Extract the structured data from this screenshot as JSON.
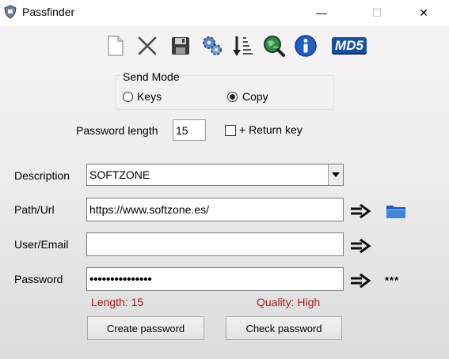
{
  "window": {
    "title": "Passfinder",
    "minimize": "—",
    "maximize": "☐",
    "close": "✕"
  },
  "toolbar": {
    "buttons": [
      {
        "icon": "new-document-icon"
      },
      {
        "icon": "delete-icon"
      },
      {
        "icon": "save-icon"
      },
      {
        "icon": "settings-gears-icon"
      },
      {
        "icon": "sort-down-icon"
      },
      {
        "icon": "search-globe-icon"
      },
      {
        "icon": "info-icon"
      },
      {
        "icon": "md5-icon",
        "label": "MD5"
      }
    ]
  },
  "send_mode": {
    "title": "Send Mode",
    "options": [
      {
        "label": "Keys",
        "selected": false
      },
      {
        "label": "Copy",
        "selected": true
      }
    ]
  },
  "password_length": {
    "label": "Password length",
    "value": "15"
  },
  "return_key": {
    "label": "+ Return key",
    "checked": false
  },
  "form": {
    "description": {
      "label": "Description",
      "value": "SOFTZONE"
    },
    "path": {
      "label": "Path/Url",
      "value": "https://www.softzone.es/"
    },
    "user": {
      "label": "User/Email",
      "value": ""
    },
    "password": {
      "label": "Password",
      "value": "•••••••••••••••",
      "reveal": "***"
    }
  },
  "stats": {
    "length": "Length: 15",
    "quality": "Quality: High"
  },
  "buttons": {
    "create": "Create password",
    "check": "Check password"
  },
  "colors": {
    "stat_text": "#a51a1a",
    "folder_blue": "#2f72c8"
  }
}
